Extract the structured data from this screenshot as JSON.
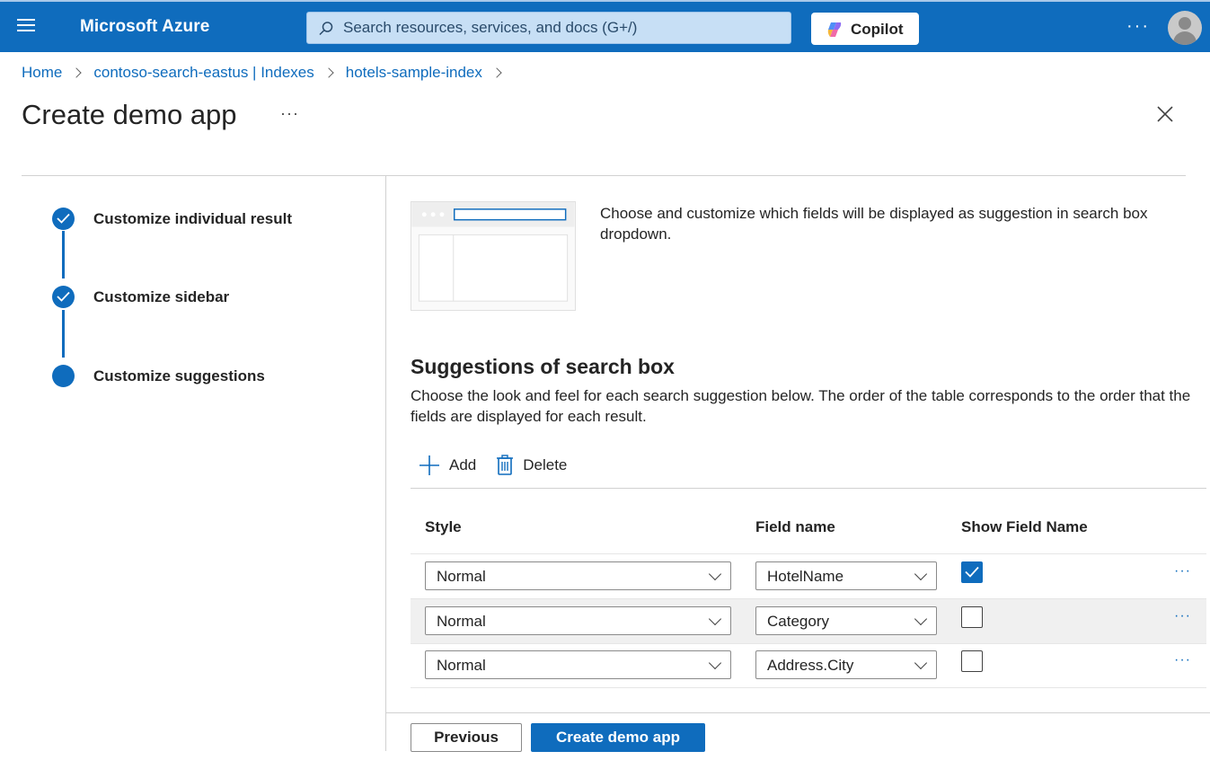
{
  "topbar": {
    "brand": "Microsoft Azure",
    "search_placeholder": "Search resources, services, and docs (G+/)",
    "copilot_label": "Copilot",
    "more": "···"
  },
  "breadcrumb": {
    "items": [
      "Home",
      "contoso-search-eastus | Indexes",
      "hotels-sample-index"
    ]
  },
  "page": {
    "title": "Create demo app",
    "more": "···"
  },
  "steps": [
    {
      "label": "Customize individual result",
      "state": "completed"
    },
    {
      "label": "Customize sidebar",
      "state": "completed"
    },
    {
      "label": "Customize suggestions",
      "state": "current"
    }
  ],
  "main": {
    "description": "Choose and customize which fields will be displayed as suggestion in search box dropdown.",
    "section_title": "Suggestions of search box",
    "section_desc": "Choose the look and feel for each search suggestion below. The order of the table corresponds to the order that the fields are displayed for each result.",
    "toolbar": {
      "add": "Add",
      "delete": "Delete"
    },
    "table": {
      "headers": [
        "Style",
        "Field name",
        "Show Field Name"
      ],
      "rows": [
        {
          "style": "Normal",
          "field": "HotelName",
          "show_field_name": true,
          "more": "···"
        },
        {
          "style": "Normal",
          "field": "Category",
          "show_field_name": false,
          "more": "···"
        },
        {
          "style": "Normal",
          "field": "Address.City",
          "show_field_name": false,
          "more": "···"
        }
      ]
    }
  },
  "footer": {
    "previous": "Previous",
    "create": "Create demo app"
  },
  "colors": {
    "accent": "#0f6cbd",
    "topbar": "#0f6cbd"
  }
}
